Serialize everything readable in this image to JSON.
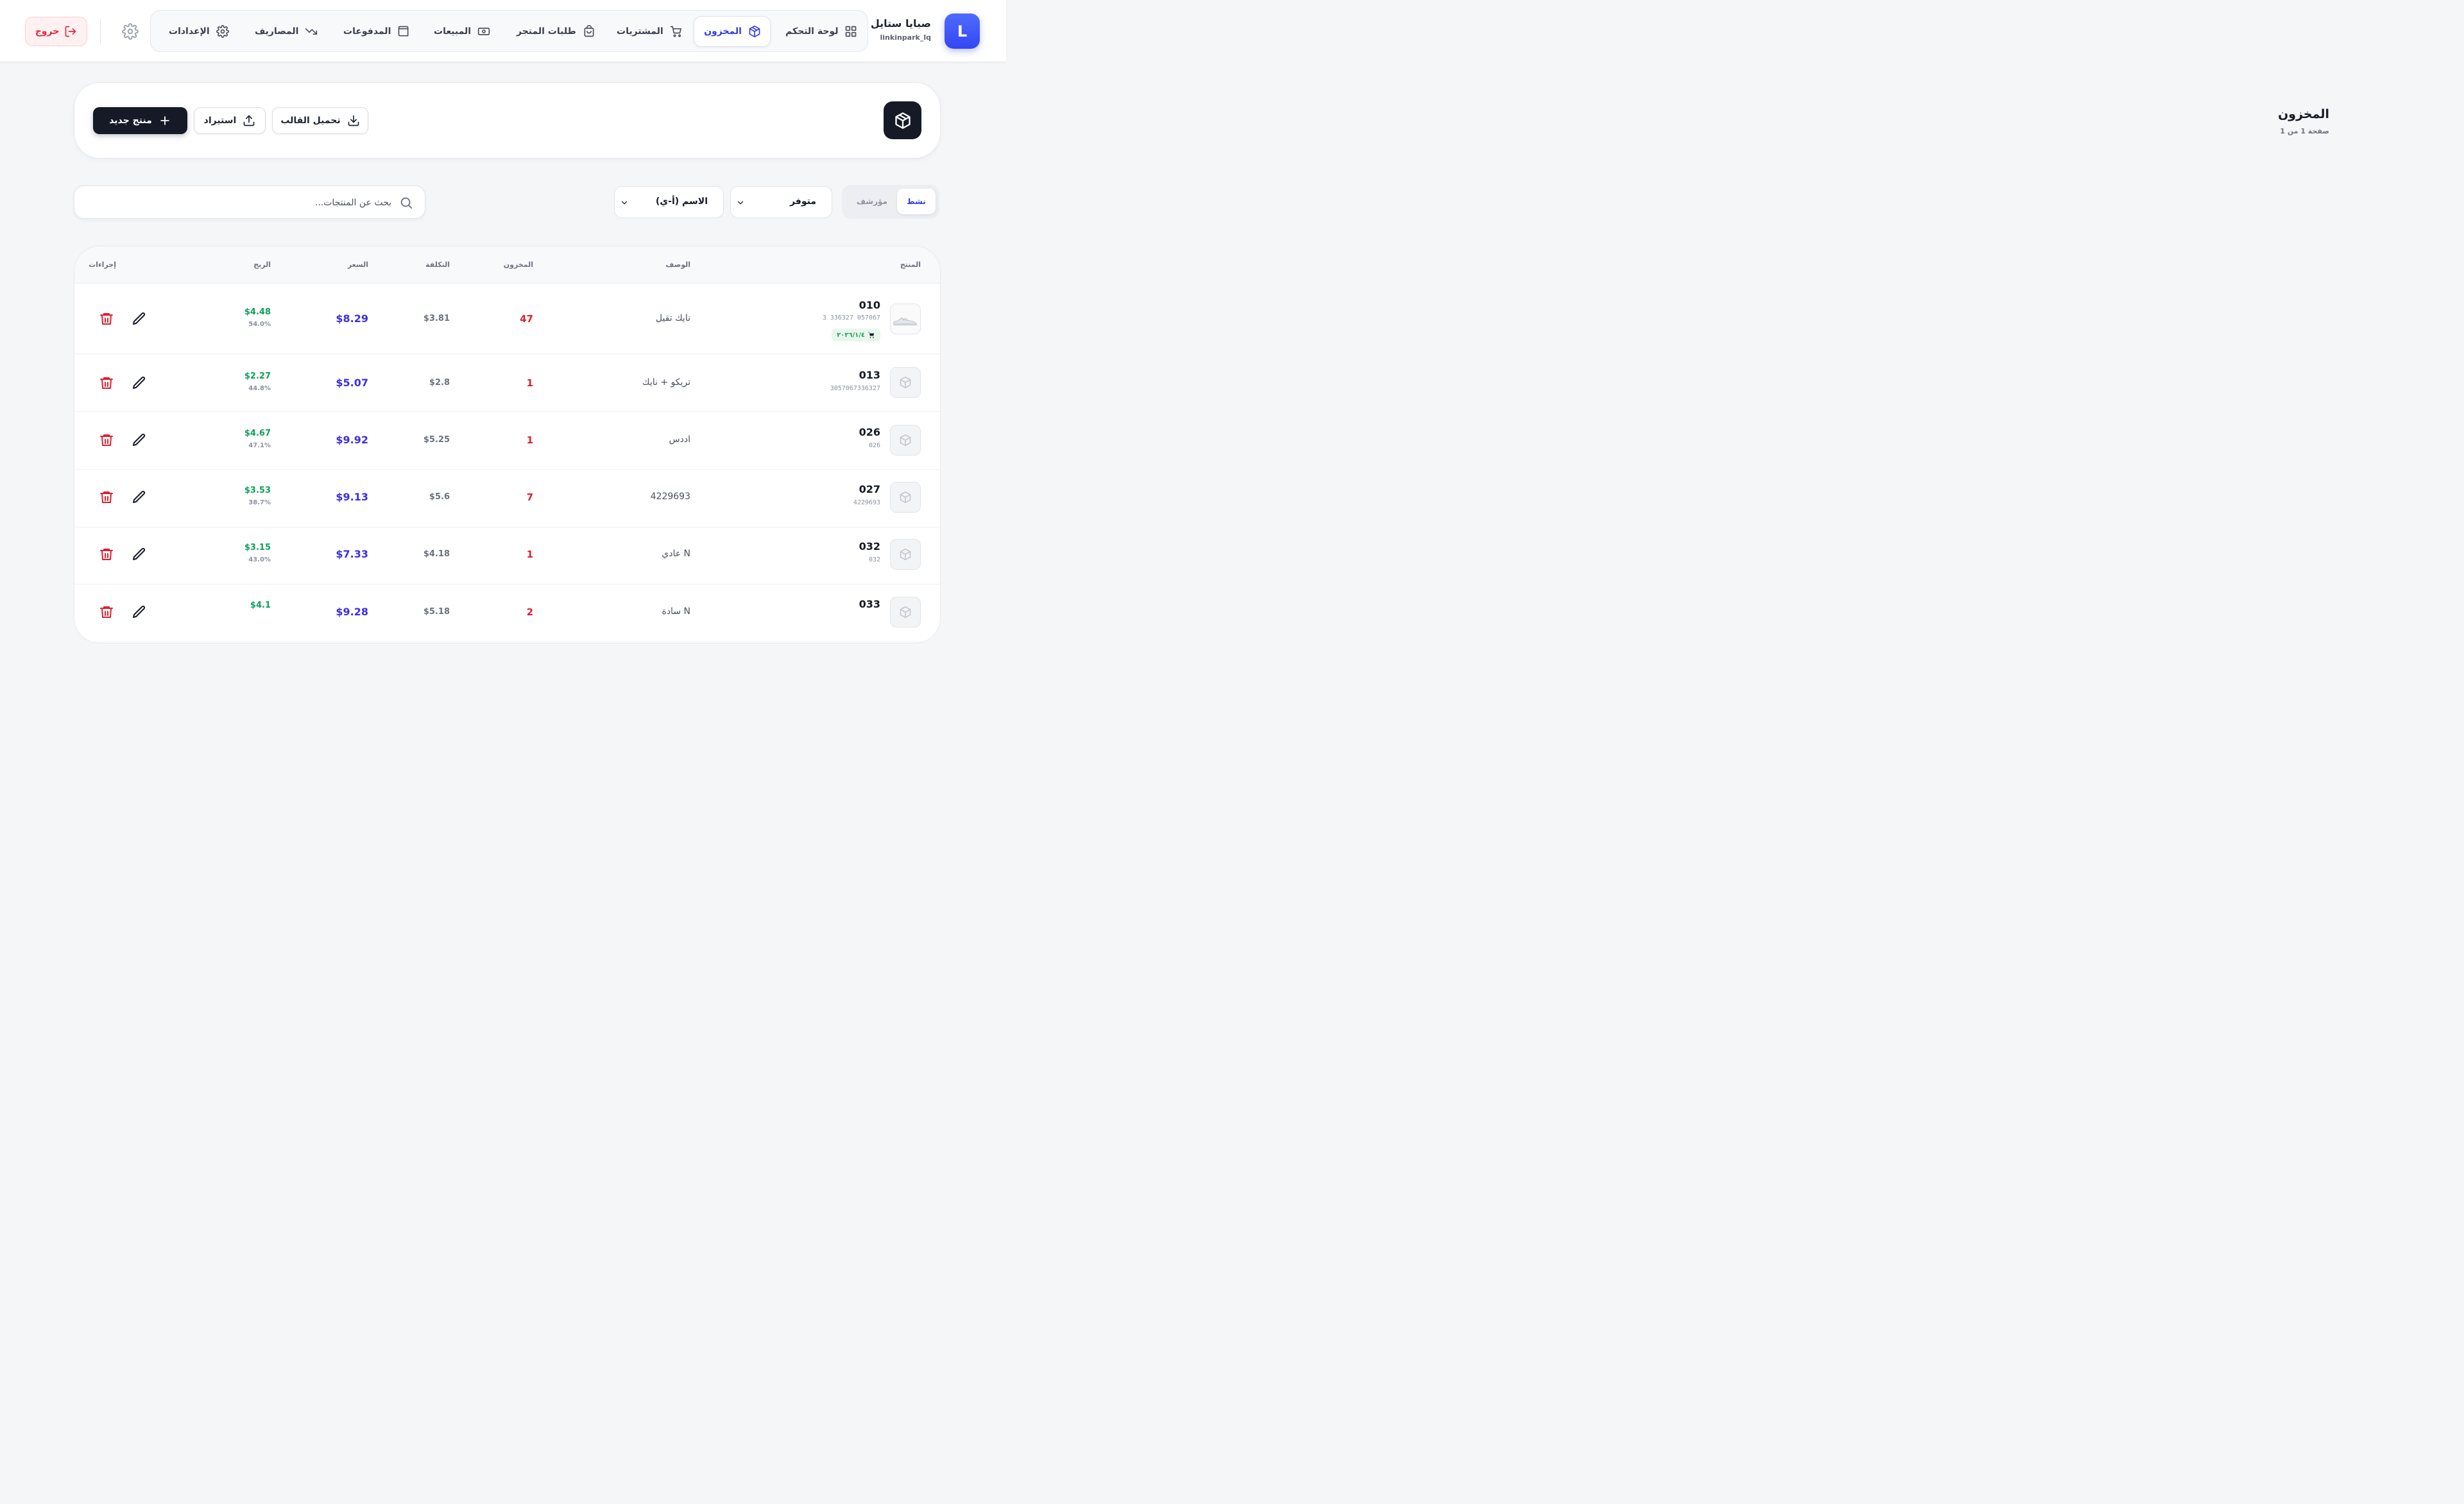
{
  "header": {
    "avatar_letter": "L",
    "store_name": "صبايا ستايل",
    "store_user": "linkinpark_lq",
    "nav": [
      {
        "label": "لوحة التحكم",
        "icon": "grid-icon"
      },
      {
        "label": "المخزون",
        "icon": "box-icon",
        "active": true
      },
      {
        "label": "المشتريات",
        "icon": "cart-icon"
      },
      {
        "label": "طلبات المتجر",
        "icon": "shopping-bag-icon"
      },
      {
        "label": "المبيعات",
        "icon": "cash-icon"
      },
      {
        "label": "المدفوعات",
        "icon": "wallet-icon"
      },
      {
        "label": "المصاريف",
        "icon": "trending-down-icon"
      },
      {
        "label": "الإعدادات",
        "icon": "gear-icon"
      }
    ],
    "logout_label": "خروج"
  },
  "page": {
    "title": "المخزون",
    "subtitle": "صفحة 1 من 1",
    "btn_new": "منتج جديد",
    "btn_import": "استيراد",
    "btn_template": "تحميل القالب"
  },
  "filters": {
    "status_active": "نشط",
    "status_archived": "مؤرشف",
    "availability": "متوفر",
    "sort": "الاسم (أ-ي)",
    "search_placeholder": "بحث عن المنتجات..."
  },
  "table": {
    "columns": {
      "product": "المنتج",
      "description": "الوصف",
      "stock": "المخزون",
      "cost": "التكلفة",
      "price": "السعر",
      "profit": "الربح",
      "actions": "إجراءات"
    },
    "rows": [
      {
        "name": "010",
        "code": "3 336327 057067",
        "tag": "٢٠٢٦/١/٤",
        "has_image": true,
        "description": "نايك تقيل",
        "stock": "47",
        "cost": "$3.81",
        "price": "$8.29",
        "profit": "$4.48",
        "margin": "54.0%"
      },
      {
        "name": "013",
        "code": "3057067336327",
        "description": "تريكو + نايك",
        "stock": "1",
        "cost": "$2.8",
        "price": "$5.07",
        "profit": "$2.27",
        "margin": "44.8%"
      },
      {
        "name": "026",
        "code": "026",
        "description": "اددس",
        "stock": "1",
        "cost": "$5.25",
        "price": "$9.92",
        "profit": "$4.67",
        "margin": "47.1%"
      },
      {
        "name": "027",
        "code": "4229693",
        "description": "4229693",
        "stock": "7",
        "cost": "$5.6",
        "price": "$9.13",
        "profit": "$3.53",
        "margin": "38.7%"
      },
      {
        "name": "032",
        "code": "032",
        "description": "عادي N",
        "stock": "1",
        "cost": "$4.18",
        "price": "$7.33",
        "profit": "$3.15",
        "margin": "43.0%"
      },
      {
        "name": "033",
        "code": "",
        "description": "سادة N",
        "stock": "2",
        "cost": "$5.18",
        "price": "$9.28",
        "profit": "$4.1",
        "margin": ""
      }
    ]
  },
  "colors": {
    "accent": "#2f3ee6",
    "price": "#3b2fe0",
    "profit": "#0f9f5a",
    "danger": "#e11d2e"
  }
}
